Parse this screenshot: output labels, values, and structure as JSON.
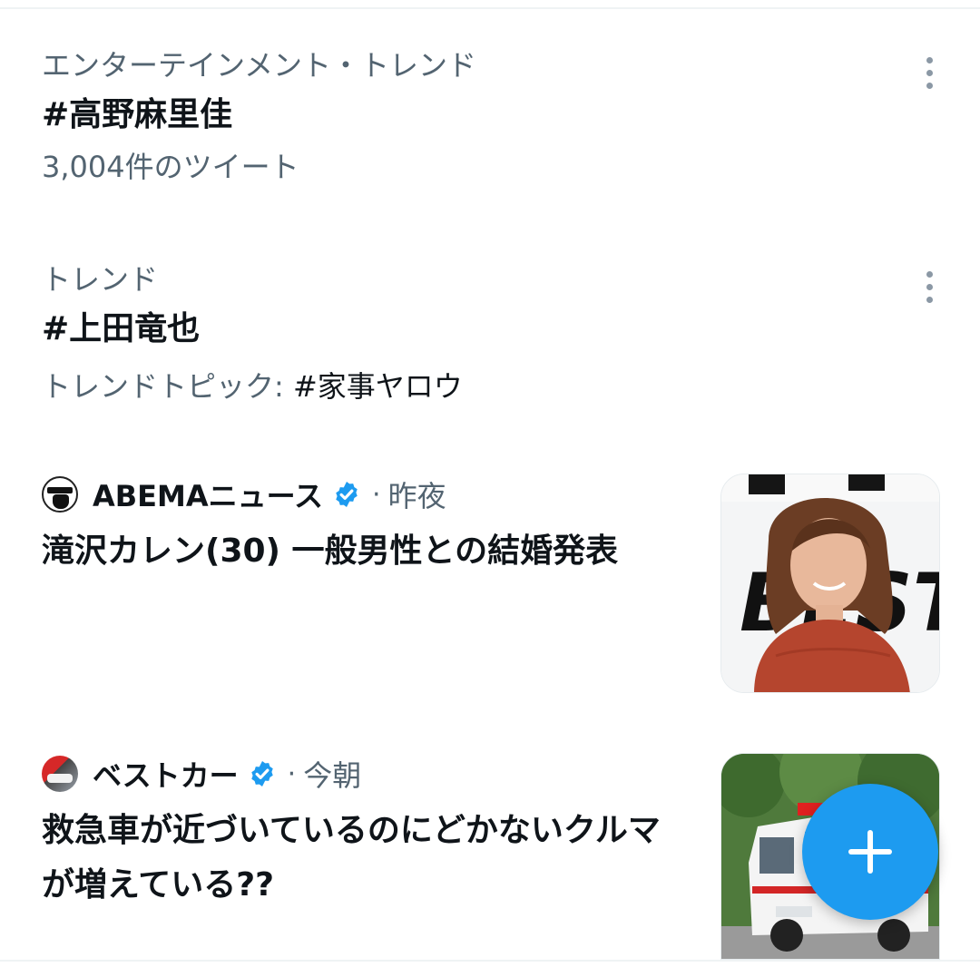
{
  "trends": [
    {
      "category": "エンターテインメント・トレンド",
      "name": "#高野麻里佳",
      "meta": "3,004件のツイート"
    },
    {
      "category": "トレンド",
      "name": "#上田竜也",
      "meta_prefix": "トレンドトピック: ",
      "meta_topic": "#家事ヤロウ"
    }
  ],
  "news": [
    {
      "source": "ABEMAニュース",
      "separator": "·",
      "time": "昨夜",
      "headline": "滝沢カレン(30) 一般男性との結婚発表",
      "thumb_letters": "BEST"
    },
    {
      "source": "ベストカー",
      "separator": "·",
      "time": "今朝",
      "headline": "救急車が近づいているのにどかないクルマが増えている??"
    }
  ],
  "colors": {
    "accent": "#1d9bf0",
    "secondary_text": "#536471",
    "primary_text": "#0f1419"
  },
  "icons": {
    "more": "more-vertical-icon",
    "verified": "verified-badge-icon",
    "compose": "plus-icon"
  }
}
